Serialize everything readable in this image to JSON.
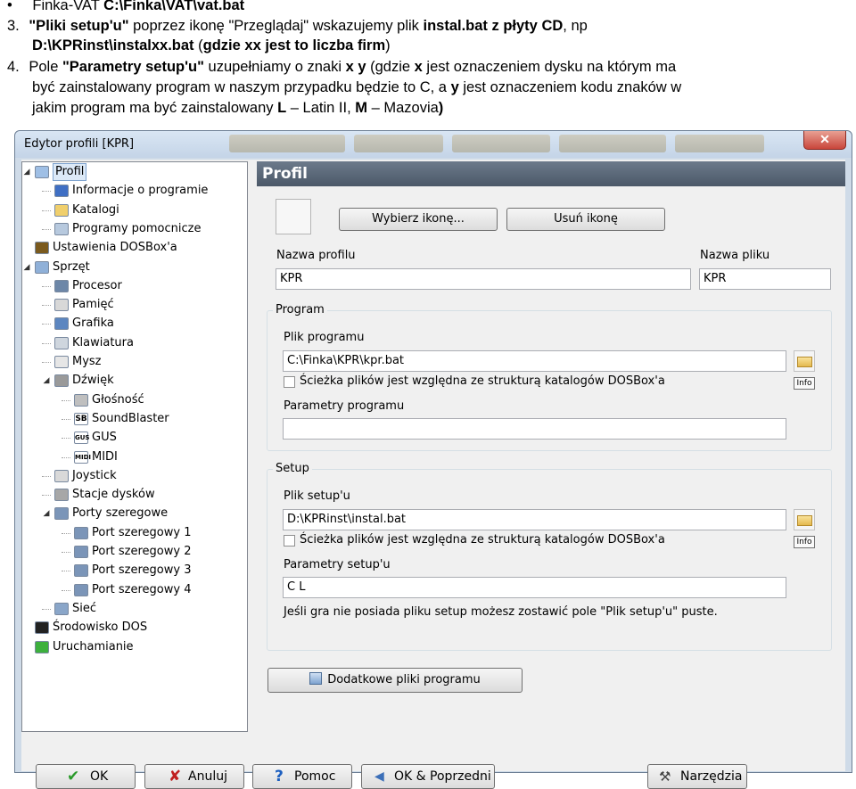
{
  "document": {
    "line1": {
      "bullet": "•",
      "prefix": "Finka-VAT ",
      "path": "C:\\Finka\\VAT\\vat.bat"
    },
    "item3": {
      "number": "3.",
      "quoted": "\"Pliki setup'u\"",
      "text1": " poprzez ikonę \"Przeglądaj\" wskazujemy plik ",
      "bold1": "instal.bat z płyty CD",
      "text2": ", np",
      "bold2": "D:\\KPRinst\\instalxx.bat",
      "text3": " (",
      "bold3": "gdzie xx jest to liczba firm",
      "text4": ")"
    },
    "item4": {
      "number": "4.",
      "text1": "Pole ",
      "quoted": "\"Parametry setup'u\"",
      "text2": " uzupełniamy o znaki ",
      "bold_xy": "x y",
      "text3": " (gdzie ",
      "bold_x": "x",
      "text4": " jest oznaczeniem dysku na którym ma",
      "line2a": "być zainstalowany program w naszym przypadku będzie to C, a ",
      "bold_y": "y",
      "line2b": " jest oznaczeniem kodu znaków w",
      "line3a": "jakim program ma być zainstalowany ",
      "bold_L": "L",
      "line3b": " – Latin II, ",
      "bold_M": "M",
      "line3c": " – Mazovia",
      "line3d": ")"
    }
  },
  "window": {
    "title": "Edytor profili [KPR]",
    "close_glyph": "✕"
  },
  "tree": [
    {
      "label": "Profil",
      "level": 1,
      "icon": "profile-icon",
      "expanded": true,
      "selected": true
    },
    {
      "label": "Informacje o programie",
      "level": 2,
      "icon": "info-icon"
    },
    {
      "label": "Katalogi",
      "level": 2,
      "icon": "folder-icon"
    },
    {
      "label": "Programy pomocnicze",
      "level": 2,
      "icon": "helper-programs-icon"
    },
    {
      "label": "Ustawienia DOSBox'a",
      "level": 1,
      "icon": "dosbox-icon"
    },
    {
      "label": "Sprzęt",
      "level": 1,
      "icon": "hardware-icon",
      "expanded": true
    },
    {
      "label": "Procesor",
      "level": 2,
      "icon": "cpu-icon"
    },
    {
      "label": "Pamięć",
      "level": 2,
      "icon": "memory-icon"
    },
    {
      "label": "Grafika",
      "level": 2,
      "icon": "monitor-icon"
    },
    {
      "label": "Klawiatura",
      "level": 2,
      "icon": "keyboard-icon"
    },
    {
      "label": "Mysz",
      "level": 2,
      "icon": "mouse-icon"
    },
    {
      "label": "Dźwięk",
      "level": 2,
      "icon": "sound-icon",
      "expanded": true
    },
    {
      "label": "Głośność",
      "level": 3,
      "icon": "volume-icon"
    },
    {
      "label": "SoundBlaster",
      "level": 3,
      "icon": "soundblaster-icon",
      "badge": "SB"
    },
    {
      "label": "GUS",
      "level": 3,
      "icon": "gus-icon",
      "badge": "GUS"
    },
    {
      "label": "MIDI",
      "level": 3,
      "icon": "midi-icon",
      "badge": "MIDI"
    },
    {
      "label": "Joystick",
      "level": 2,
      "icon": "joystick-icon"
    },
    {
      "label": "Stacje dysków",
      "level": 2,
      "icon": "drive-icon"
    },
    {
      "label": "Porty szeregowe",
      "level": 2,
      "icon": "serial-ports-icon",
      "expanded": true
    },
    {
      "label": "Port szeregowy 1",
      "level": 3,
      "icon": "serial-port-icon"
    },
    {
      "label": "Port szeregowy 2",
      "level": 3,
      "icon": "serial-port-icon"
    },
    {
      "label": "Port szeregowy 3",
      "level": 3,
      "icon": "serial-port-icon"
    },
    {
      "label": "Port szeregowy 4",
      "level": 3,
      "icon": "serial-port-icon"
    },
    {
      "label": "Sieć",
      "level": 2,
      "icon": "network-icon"
    },
    {
      "label": "Środowisko DOS",
      "level": 1,
      "icon": "dos-icon"
    },
    {
      "label": "Uruchamianie",
      "level": 1,
      "icon": "run-icon"
    }
  ],
  "panel": {
    "header": "Profil",
    "choose_icon_label": "Wybierz ikonę...",
    "remove_icon_label": "Usuń ikonę",
    "profile_name_label": "Nazwa profilu",
    "profile_name_value": "KPR",
    "file_name_label": "Nazwa pliku",
    "file_name_value": "KPR",
    "program_group": {
      "caption": "Program",
      "file_label": "Plik programu",
      "file_value": "C:\\Finka\\KPR\\kpr.bat",
      "relative_label": "Ścieżka plików jest względna ze strukturą katalogów DOSBox'a",
      "info_label": "Info",
      "params_label": "Parametry programu",
      "params_value": ""
    },
    "setup_group": {
      "caption": "Setup",
      "file_label": "Plik setup'u",
      "file_value": "D:\\KPRinst\\instal.bat",
      "relative_label": "Ścieżka plików jest względna ze strukturą katalogów DOSBox'a",
      "info_label": "Info",
      "params_label": "Parametry setup'u",
      "params_value": "C L",
      "note": "Jeśli gra nie posiada pliku setup możesz zostawić pole \"Plik setup'u\" puste."
    },
    "extra_files_label": "Dodatkowe pliki programu"
  },
  "buttons": {
    "ok": "OK",
    "cancel": "Anuluj",
    "help": "Pomoc",
    "ok_prev": "OK & Poprzedni",
    "tools": "Narzędzia"
  },
  "colors": {
    "header_bg": "#55626f",
    "ok_check": "#2a9a2a",
    "cancel_x": "#c02020",
    "help_q": "#1d5fbf"
  }
}
